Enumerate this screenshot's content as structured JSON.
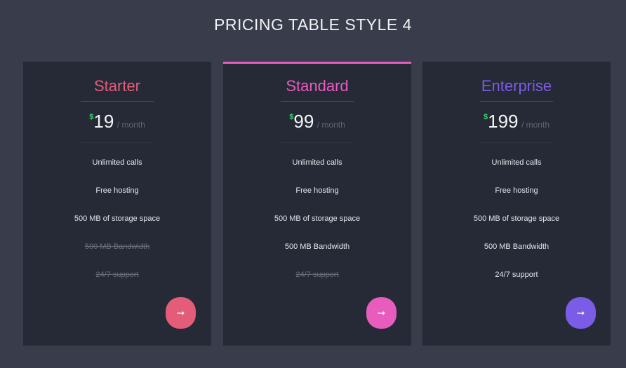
{
  "page": {
    "title": "PRICING TABLE STYLE 4"
  },
  "colors": {
    "background": "#393d4b",
    "card": "#262a36",
    "currency": "#3ecf6e",
    "starter": "#e35d7a",
    "standard": "#e85cbe",
    "enterprise": "#7b5ce6"
  },
  "plans": [
    {
      "name": "Starter",
      "currency": "$",
      "amount": "19",
      "period": "/ month",
      "color": "#e35d7a",
      "features": [
        {
          "text": "Unlimited calls",
          "included": true
        },
        {
          "text": "Free hosting",
          "included": true
        },
        {
          "text": "500 MB of storage space",
          "included": true
        },
        {
          "text": "500 MB Bandwidth",
          "included": false
        },
        {
          "text": "24/7 support",
          "included": false
        }
      ],
      "button_icon": "arrow-right-icon",
      "button_glyph": "➞"
    },
    {
      "name": "Standard",
      "currency": "$",
      "amount": "99",
      "period": "/ month",
      "color": "#e85cbe",
      "features": [
        {
          "text": "Unlimited calls",
          "included": true
        },
        {
          "text": "Free hosting",
          "included": true
        },
        {
          "text": "500 MB of storage space",
          "included": true
        },
        {
          "text": "500 MB Bandwidth",
          "included": true
        },
        {
          "text": "24/7 support",
          "included": false
        }
      ],
      "button_icon": "arrow-right-icon",
      "button_glyph": "➞"
    },
    {
      "name": "Enterprise",
      "currency": "$",
      "amount": "199",
      "period": "/ month",
      "color": "#7b5ce6",
      "features": [
        {
          "text": "Unlimited calls",
          "included": true
        },
        {
          "text": "Free hosting",
          "included": true
        },
        {
          "text": "500 MB of storage space",
          "included": true
        },
        {
          "text": "500 MB Bandwidth",
          "included": true
        },
        {
          "text": "24/7 support",
          "included": true
        }
      ],
      "button_icon": "arrow-right-icon",
      "button_glyph": "➞"
    }
  ]
}
